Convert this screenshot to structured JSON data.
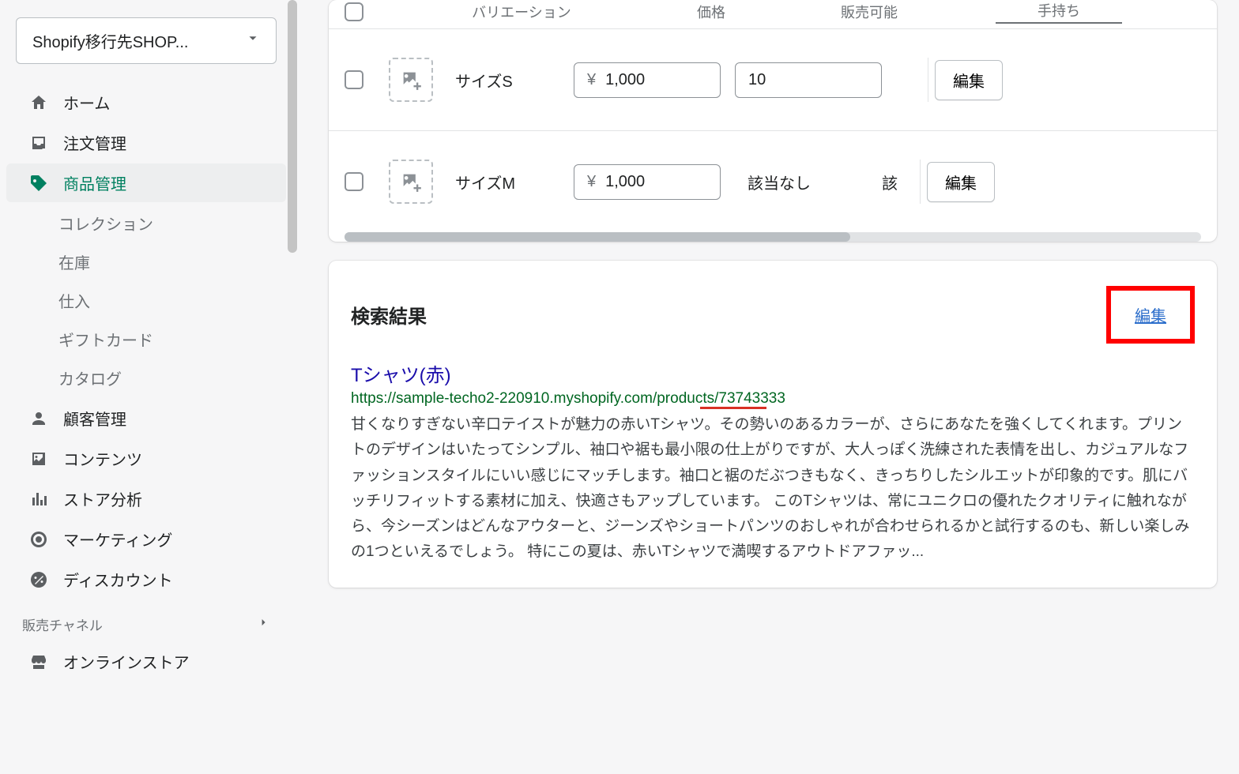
{
  "store_selector": {
    "label": "Shopify移行先SHOP..."
  },
  "nav": {
    "home": "ホーム",
    "orders": "注文管理",
    "products": "商品管理",
    "sub": {
      "collections": "コレクション",
      "inventory": "在庫",
      "purchase": "仕入",
      "gift_cards": "ギフトカード",
      "catalog": "カタログ"
    },
    "customers": "顧客管理",
    "content": "コンテンツ",
    "analytics": "ストア分析",
    "marketing": "マーケティング",
    "discounts": "ディスカウント",
    "section_channels": "販売チャネル",
    "online_store": "オンラインストア"
  },
  "variants": {
    "headers": {
      "variation": "バリエーション",
      "price": "価格",
      "available": "販売可能",
      "on_hand": "手持ち"
    },
    "rows": [
      {
        "name": "サイズS",
        "currency": "¥",
        "price": "1,000",
        "available": "10",
        "available_input": true,
        "on_hand": "",
        "edit": "編集"
      },
      {
        "name": "サイズM",
        "currency": "¥",
        "price": "1,000",
        "available": "該当なし",
        "available_input": false,
        "on_hand": "該",
        "edit": "編集"
      }
    ]
  },
  "search_result": {
    "section_title": "検索結果",
    "edit_link": "編集",
    "title": "Tシャツ(赤)",
    "url": "https://sample-techo2-220910.myshopify.com/products/73743333",
    "underline": {
      "left_pct": 80.4,
      "width_pct": 15.2
    },
    "description": "甘くなりすぎない辛口テイストが魅力の赤いTシャツ。その勢いのあるカラーが、さらにあなたを強くしてくれます。プリントのデザインはいたってシンプル、袖口や裾も最小限の仕上がりですが、大人っぽく洗練された表情を出し、カジュアルなファッションスタイルにいい感じにマッチします。袖口と裾のだぶつきもなく、きっちりしたシルエットが印象的です。肌にバッチリフィットする素材に加え、快適さもアップしています。 このTシャツは、常にユニクロの優れたクオリティに触れながら、今シーズンはどんなアウターと、ジーンズやショートパンツのおしゃれが合わせられるかと試行するのも、新しい楽しみの1つといえるでしょう。 特にこの夏は、赤いTシャツで満喫するアウトドアファッ..."
  }
}
